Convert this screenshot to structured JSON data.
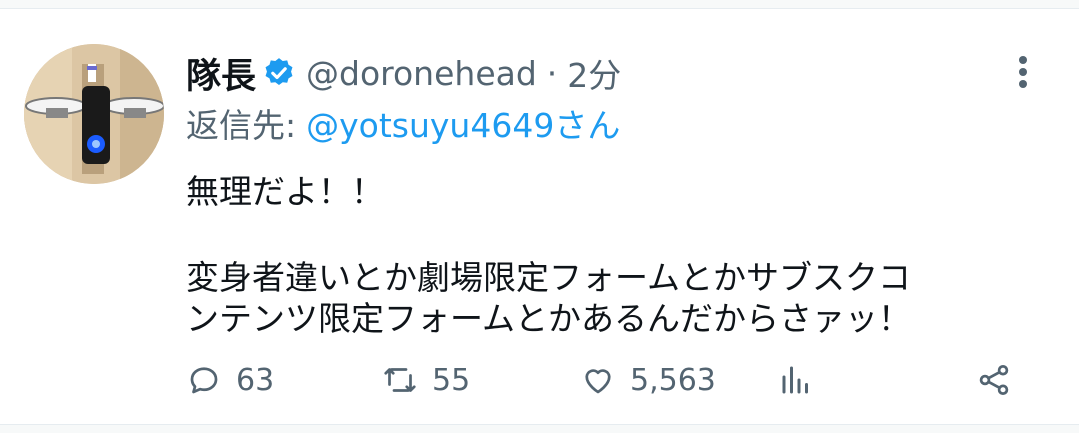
{
  "tweet": {
    "display_name": "隊長",
    "handle": "@doronehead",
    "separator": "·",
    "time": "2分",
    "reply_prefix": "返信先:",
    "reply_to": "@yotsuyu4649さん",
    "text_line1": "無理だよ！！",
    "text_line2": "変身者違いとか劇場限定フォームとかサブスクコ",
    "text_line3": "ンテンツ限定フォームとかあるんだからさァッ！"
  },
  "actions": {
    "replies": "63",
    "retweets": "55",
    "likes": "5,563"
  },
  "colors": {
    "accent": "#1d9bf0",
    "secondary_text": "#536471",
    "primary_text": "#0f1419"
  },
  "icons": [
    "verified-badge-icon",
    "more-options-icon",
    "reply-icon",
    "retweet-icon",
    "like-icon",
    "stats-icon",
    "share-icon"
  ]
}
